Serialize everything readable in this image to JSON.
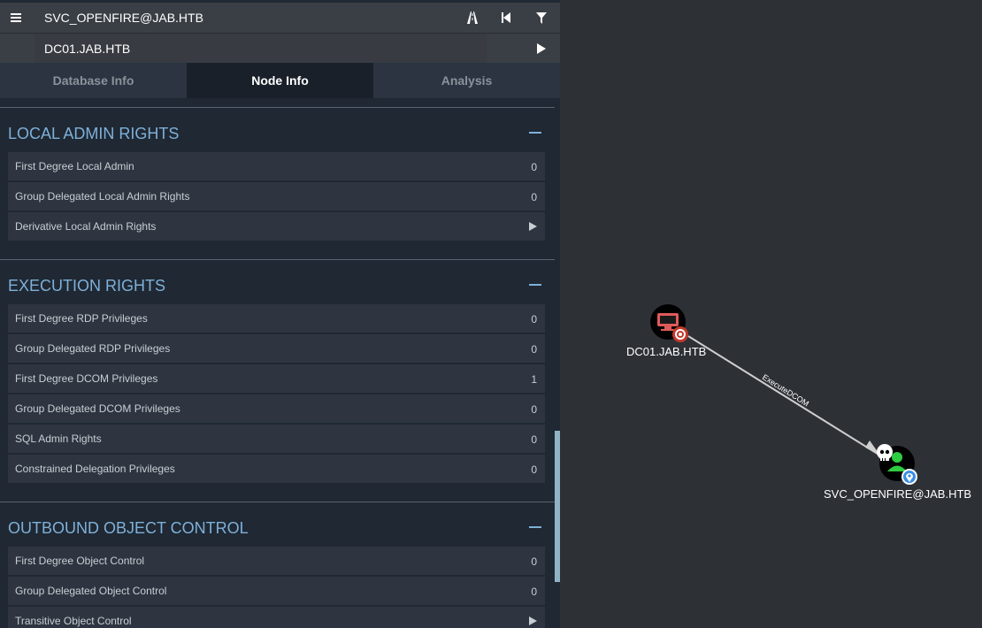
{
  "search": {
    "source": "SVC_OPENFIRE@JAB.HTB",
    "target": "DC01.JAB.HTB"
  },
  "tabs": [
    {
      "label": "Database Info"
    },
    {
      "label": "Node Info"
    },
    {
      "label": "Analysis"
    }
  ],
  "sections": {
    "local_admin": {
      "title": "LOCAL ADMIN RIGHTS",
      "rows": [
        {
          "label": "First Degree Local Admin",
          "value": "0"
        },
        {
          "label": "Group Delegated Local Admin Rights",
          "value": "0"
        },
        {
          "label": "Derivative Local Admin Rights",
          "value": ""
        }
      ]
    },
    "execution": {
      "title": "EXECUTION RIGHTS",
      "rows": [
        {
          "label": "First Degree RDP Privileges",
          "value": "0"
        },
        {
          "label": "Group Delegated RDP Privileges",
          "value": "0"
        },
        {
          "label": "First Degree DCOM Privileges",
          "value": "1"
        },
        {
          "label": "Group Delegated DCOM Privileges",
          "value": "0"
        },
        {
          "label": "SQL Admin Rights",
          "value": "0"
        },
        {
          "label": "Constrained Delegation Privileges",
          "value": "0"
        }
      ]
    },
    "outbound": {
      "title": "OUTBOUND OBJECT CONTROL",
      "rows": [
        {
          "label": "First Degree Object Control",
          "value": "0"
        },
        {
          "label": "Group Delegated Object Control",
          "value": "0"
        },
        {
          "label": "Transitive Object Control",
          "value": ""
        }
      ]
    }
  },
  "graph": {
    "nodes": [
      {
        "label": "DC01.JAB.HTB",
        "icon": "computer-icon"
      },
      {
        "label": "SVC_OPENFIRE@JAB.HTB",
        "icon": "user-icon"
      }
    ],
    "edge_label": "ExecuteDCOM"
  },
  "colors": {
    "panel": "#1f2833",
    "section_title": "#7fb0d8",
    "row": "#2e3540",
    "graph_bg": "#2d3136",
    "computer_node": "#e05a5a",
    "user_node": "#2ecc40"
  }
}
